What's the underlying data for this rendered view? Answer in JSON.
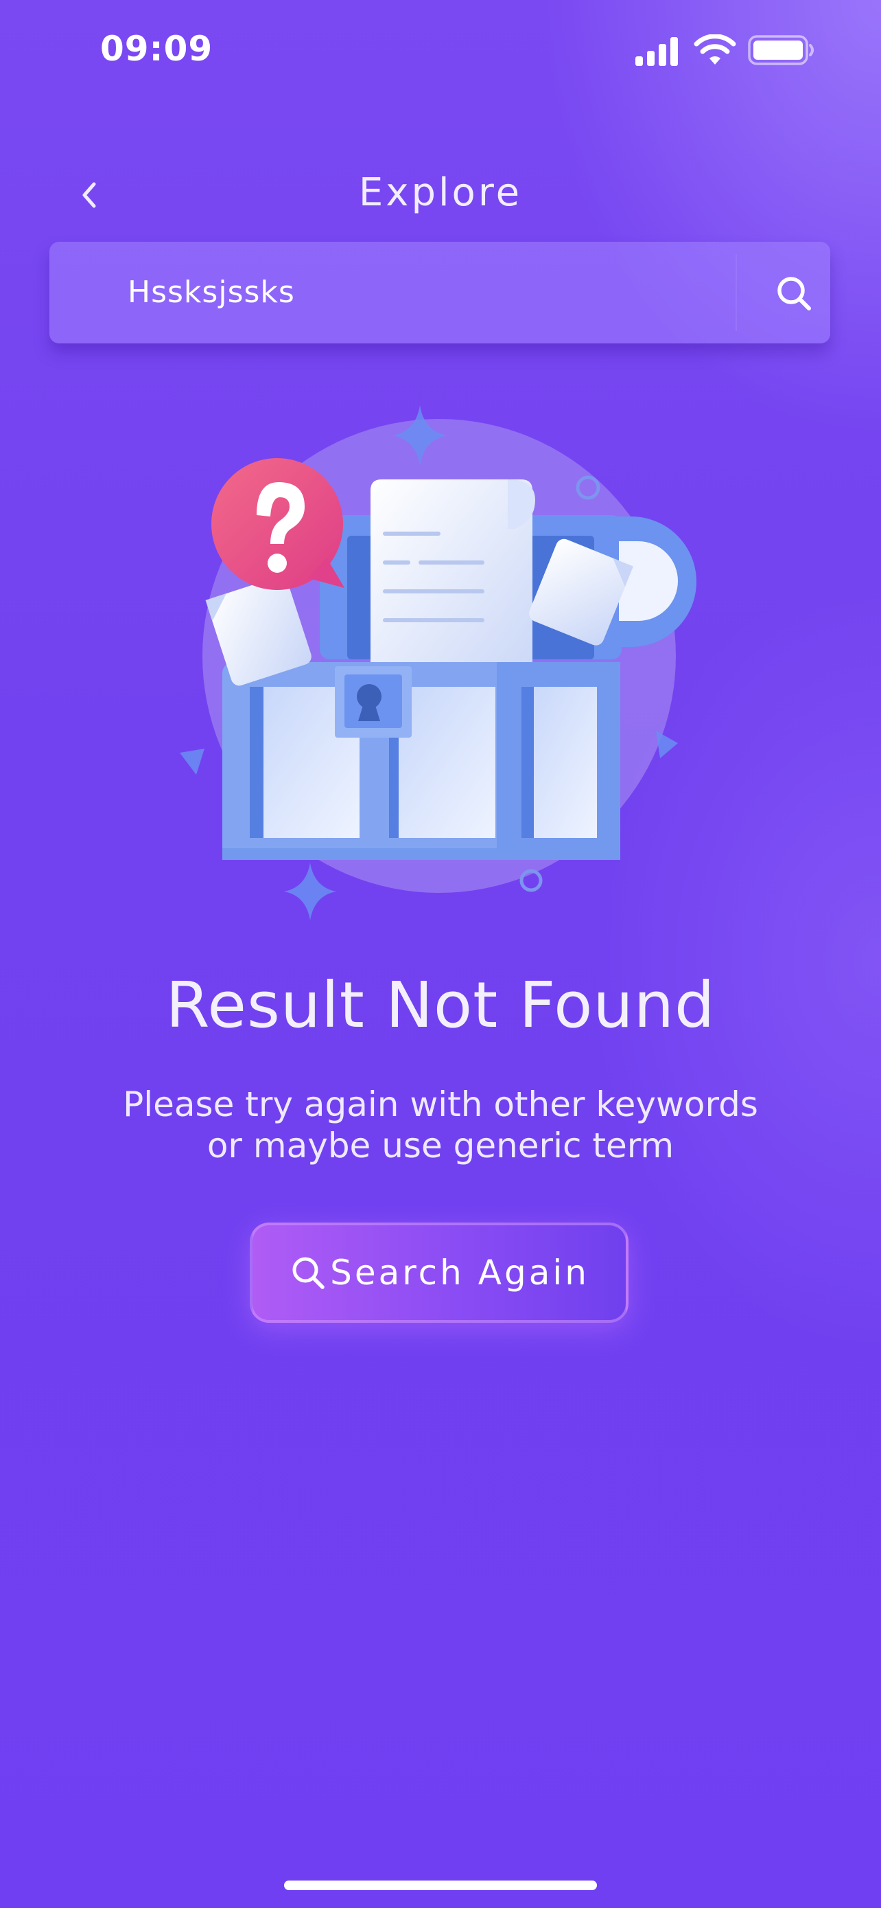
{
  "status_bar": {
    "time": "09:09",
    "icons": [
      "cellular-signal-icon",
      "wifi-icon",
      "battery-icon"
    ]
  },
  "header": {
    "title": "Explore",
    "back_icon": "chevron-left-icon"
  },
  "search": {
    "value": "Hssksjssks",
    "icon": "search-icon"
  },
  "empty_state": {
    "illustration": "treasure-chest-documents-question-illustration",
    "title": "Result Not Found",
    "message_line1": "Please try again with other keywords",
    "message_line2": "or maybe use generic term",
    "button_label": "Search Again",
    "button_icon": "search-icon"
  },
  "colors": {
    "background": "#7242f0",
    "button_start": "#b05cf5",
    "button_end": "#7040ee",
    "question_bubble": "#ec4b86"
  }
}
